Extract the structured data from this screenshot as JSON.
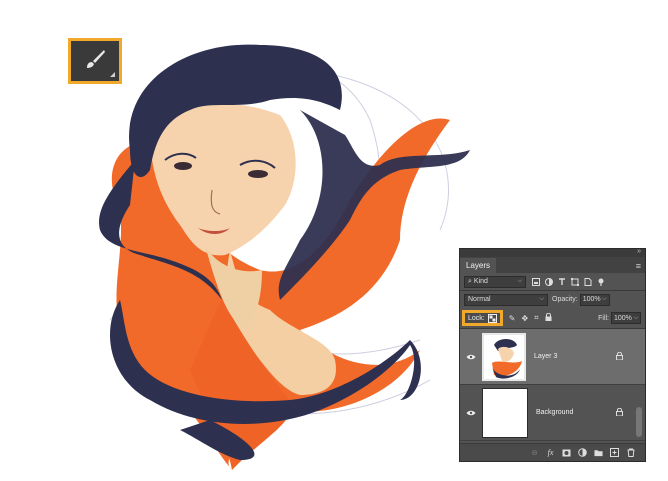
{
  "panel": {
    "tab_label": "Layers",
    "menu_icon": "panel-menu-icon",
    "collapse_icon": "double-chevron-icon"
  },
  "filter": {
    "kind_label": "Kind",
    "icons": [
      "pixel-filter-icon",
      "adjustment-filter-icon",
      "type-filter-icon",
      "shape-filter-icon",
      "smart-object-filter-icon",
      "filter-toggle-icon"
    ]
  },
  "blend": {
    "mode": "Normal",
    "opacity_label": "Opacity:",
    "opacity_value": "100%"
  },
  "lock": {
    "label": "Lock:",
    "fill_label": "Fill:",
    "fill_value": "100%"
  },
  "layers": [
    {
      "name": "Layer 3",
      "selected": true
    },
    {
      "name": "Background",
      "selected": false
    }
  ],
  "footer": {
    "icons": [
      "link-layers-icon",
      "fx-icon",
      "mask-icon",
      "adjustment-layer-icon",
      "group-icon",
      "new-layer-icon",
      "trash-icon"
    ],
    "fx_label": "fx"
  },
  "colors": {
    "highlight": "#f0a92a",
    "panel_bg": "#535353",
    "hair_dark": "#2e3050",
    "hair_orange": "#f26a2a",
    "skin": "#f4cfa4"
  }
}
